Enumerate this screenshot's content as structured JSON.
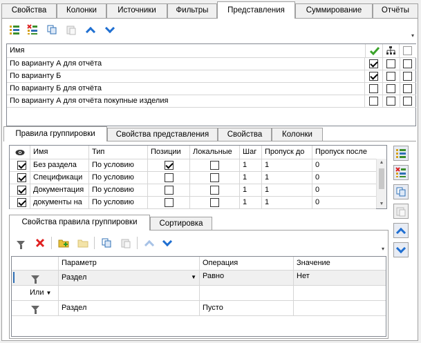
{
  "top_tabs": [
    "Свойства",
    "Колонки",
    "Источники",
    "Фильтры",
    "Представления",
    "Суммирование",
    "Отчёты"
  ],
  "top_active": "Представления",
  "views_grid": {
    "header_name": "Имя",
    "rows": [
      {
        "name": "По варианту А для отчёта",
        "c1": true,
        "c2": false,
        "c3": false
      },
      {
        "name": "По варианту Б",
        "c1": true,
        "c2": false,
        "c3": false
      },
      {
        "name": "По варианту Б для отчёта",
        "c1": false,
        "c2": false,
        "c3": false
      },
      {
        "name": "По варианту А для отчёта покупные изделия",
        "c1": false,
        "c2": false,
        "c3": false
      }
    ]
  },
  "mid_tabs": [
    "Правила группировки",
    "Свойства представления",
    "Свойства",
    "Колонки"
  ],
  "rules_grid": {
    "headers": [
      "Имя",
      "Тип",
      "Позиции",
      "Локальные",
      "Шаг",
      "Пропуск до",
      "Пропуск после"
    ],
    "rows": [
      {
        "name": "Без раздела",
        "type": "По условию",
        "pos": true,
        "local": false,
        "step": "1",
        "skip_before": "1",
        "skip_after": "0"
      },
      {
        "name": "Спецификаци",
        "type": "По условию",
        "pos": false,
        "local": false,
        "step": "1",
        "skip_before": "1",
        "skip_after": "0"
      },
      {
        "name": "Документация",
        "type": "По условию",
        "pos": false,
        "local": false,
        "step": "1",
        "skip_before": "1",
        "skip_after": "0"
      },
      {
        "name": "документы на",
        "type": "По условию",
        "pos": false,
        "local": false,
        "step": "1",
        "skip_before": "1",
        "skip_after": "0"
      }
    ]
  },
  "inner_tabs": [
    "Свойства правила группировки",
    "Сортировка"
  ],
  "cond_grid": {
    "headers": [
      "Параметр",
      "Операция",
      "Значение"
    ],
    "rows": [
      {
        "param": "Раздел",
        "op": "Равно",
        "val": "Нет"
      },
      {
        "logic": "Или"
      },
      {
        "param": "Раздел",
        "op": "Пусто",
        "val": ""
      }
    ]
  }
}
